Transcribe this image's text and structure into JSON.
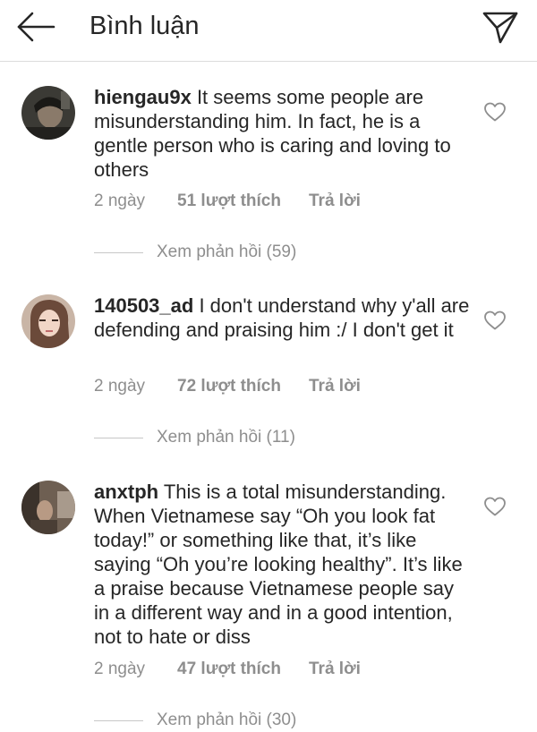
{
  "header": {
    "title": "Bình luận",
    "back_icon": "arrow-left-icon",
    "share_icon": "paper-plane-icon"
  },
  "comments": [
    {
      "username": "hiengau9x",
      "text": "It seems some people are misunderstanding him. In fact, he is a gentle person who is caring and loving to others",
      "time": "2 ngày",
      "likes": "51 lượt thích",
      "reply_label": "Trả lời",
      "replies_label": "Xem phản hồi (59)"
    },
    {
      "username": "140503_ad",
      "text": "I don't understand why y'all are defending  and praising him :/ I don't get it",
      "time": "2 ngày",
      "likes": "72 lượt thích",
      "reply_label": "Trả lời",
      "replies_label": "Xem phản hồi (11)"
    },
    {
      "username": "anxtph",
      "text": "This is a total misunderstanding. When Vietnamese say “Oh you look fat today!” or something like that, it’s like saying “Oh you’re looking healthy”. It’s like a praise because Vietnamese people say in a different way and in a good intention, not to hate or diss",
      "time": "2 ngày",
      "likes": "47 lượt thích",
      "reply_label": "Trả lời",
      "replies_label": "Xem phản hồi (30)"
    }
  ],
  "colors": {
    "text": "#262626",
    "secondary": "#8e8e8e",
    "divider": "#dbdbdb"
  }
}
